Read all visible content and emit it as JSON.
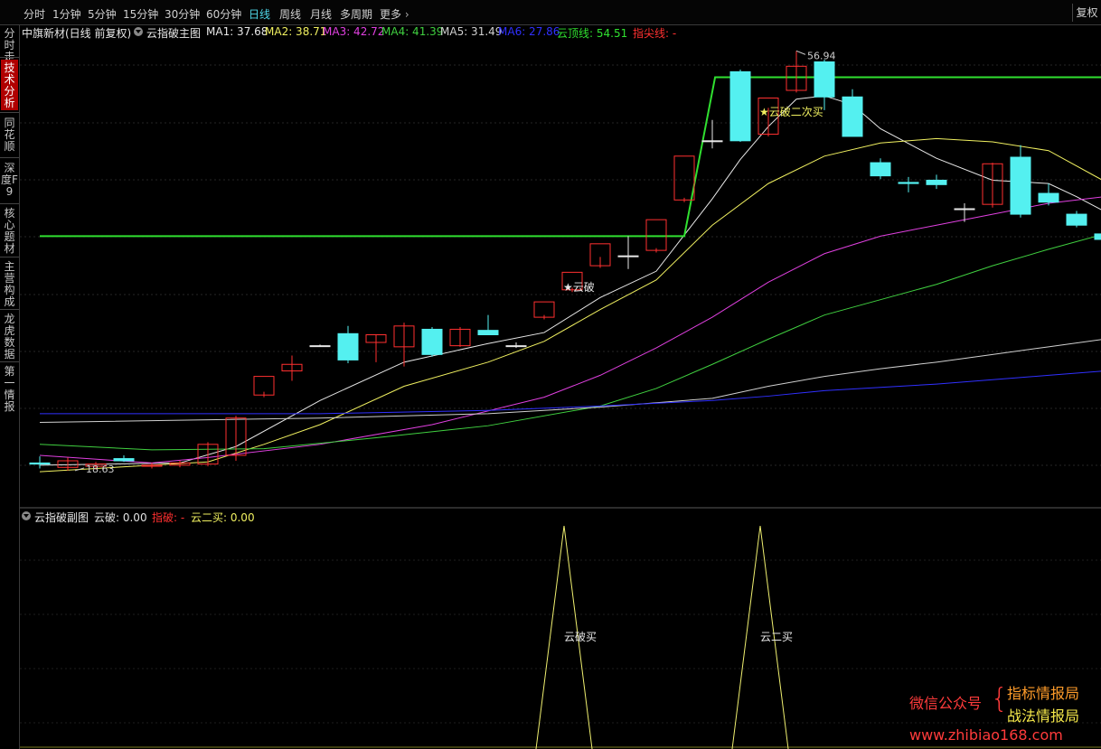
{
  "toolbar": {
    "periods": [
      "分时",
      "1分钟",
      "5分钟",
      "15分钟",
      "30分钟",
      "60分钟",
      "日线",
      "周线",
      "月线",
      "多周期",
      "更多"
    ],
    "active_period": "日线",
    "fuquan_label": "复权"
  },
  "sidebar": {
    "tabs": [
      "分时走势",
      "技术分析",
      "同花顺",
      "深度F9",
      "核心题材",
      "主营构成",
      "龙虎数据",
      "第一情报"
    ],
    "active_tab": "技术分析"
  },
  "main_header": {
    "stock": "中旗新材(日线 前复权)",
    "indicator": "云指破主图",
    "items": [
      {
        "label": "MA1: 37.68",
        "color": "#e8e8e8"
      },
      {
        "label": "MA2: 38.71",
        "color": "#f0f060"
      },
      {
        "label": "MA3: 42.72",
        "color": "#e040e0"
      },
      {
        "label": "MA4: 41.39",
        "color": "#40d040"
      },
      {
        "label": "MA5: 31.49",
        "color": "#d0d0d0"
      },
      {
        "label": "MA6: 27.86",
        "color": "#3030ff"
      },
      {
        "label": "云顶线: 54.51",
        "color": "#30e030"
      },
      {
        "label": "指尖线: -",
        "color": "#ff3030"
      }
    ]
  },
  "sub_header": {
    "indicator": "云指破副图",
    "items": [
      {
        "label": "云破: 0.00",
        "color": "#e0e0e0"
      },
      {
        "label": "指破: -",
        "color": "#ff3030"
      },
      {
        "label": "云二买: 0.00",
        "color": "#f0f060"
      }
    ]
  },
  "chart_data": {
    "type": "candlestick",
    "ylim": [
      17,
      58
    ],
    "high_label": "56.94",
    "low_label": "18.63",
    "colors": {
      "up": "#ff3030",
      "down": "#54f0f0",
      "doji": "#e8e8e8",
      "cloud_top": "#30e030",
      "background": "#000000"
    },
    "candles": [
      {
        "o": 19.3,
        "h": 19.9,
        "l": 18.8,
        "c": 19.2
      },
      {
        "o": 18.9,
        "h": 19.8,
        "l": 18.6,
        "c": 19.5
      },
      {
        "o": 19.0,
        "h": 19.4,
        "l": 18.7,
        "c": 19.2
      },
      {
        "o": 19.7,
        "h": 20.0,
        "l": 19.4,
        "c": 19.5
      },
      {
        "o": 19.0,
        "h": 19.3,
        "l": 18.8,
        "c": 19.1
      },
      {
        "o": 19.1,
        "h": 19.5,
        "l": 18.9,
        "c": 19.3
      },
      {
        "o": 19.2,
        "h": 21.2,
        "l": 19.0,
        "c": 21.0
      },
      {
        "o": 20.0,
        "h": 23.6,
        "l": 19.5,
        "c": 23.4
      },
      {
        "o": 25.5,
        "h": 25.8,
        "l": 25.3,
        "c": 27.2
      },
      {
        "o": 27.7,
        "h": 29.1,
        "l": 26.8,
        "c": 28.3
      },
      {
        "o": 30.0,
        "h": 30.1,
        "l": 29.9,
        "c": 30.0
      },
      {
        "o": 31.1,
        "h": 31.8,
        "l": 28.4,
        "c": 28.7
      },
      {
        "o": 30.3,
        "h": 31.0,
        "l": 28.5,
        "c": 31.0
      },
      {
        "o": 29.9,
        "h": 32.1,
        "l": 28.1,
        "c": 31.8
      },
      {
        "o": 31.5,
        "h": 31.7,
        "l": 29.0,
        "c": 29.2
      },
      {
        "o": 30.0,
        "h": 31.7,
        "l": 29.9,
        "c": 31.5
      },
      {
        "o": 31.4,
        "h": 32.8,
        "l": 31.0,
        "c": 31.0
      },
      {
        "o": 30.0,
        "h": 30.3,
        "l": 29.8,
        "c": 30.0
      },
      {
        "o": 32.6,
        "h": 32.8,
        "l": 32.4,
        "c": 34.0
      },
      {
        "o": 35.1,
        "h": 35.3,
        "l": 34.9,
        "c": 36.7
      },
      {
        "o": 37.3,
        "h": 38.1,
        "l": 37.1,
        "c": 39.3
      },
      {
        "o": 38.2,
        "h": 40.0,
        "l": 37.0,
        "c": 38.2
      },
      {
        "o": 38.7,
        "h": 38.9,
        "l": 38.5,
        "c": 41.5
      },
      {
        "o": 43.3,
        "h": 43.5,
        "l": 43.1,
        "c": 47.3
      },
      {
        "o": 48.7,
        "h": 50.6,
        "l": 48.0,
        "c": 48.7
      },
      {
        "o": 55.0,
        "h": 55.2,
        "l": 48.6,
        "c": 48.7
      },
      {
        "o": 49.3,
        "h": 51.7,
        "l": 49.1,
        "c": 52.6
      },
      {
        "o": 53.3,
        "h": 56.9,
        "l": 53.1,
        "c": 55.5
      },
      {
        "o": 55.9,
        "h": 56.1,
        "l": 51.5,
        "c": 52.7
      },
      {
        "o": 52.7,
        "h": 53.4,
        "l": 49.1,
        "c": 49.1
      },
      {
        "o": 46.7,
        "h": 47.1,
        "l": 45.2,
        "c": 45.5
      },
      {
        "o": 44.9,
        "h": 45.4,
        "l": 44.0,
        "c": 44.8
      },
      {
        "o": 45.1,
        "h": 45.6,
        "l": 44.3,
        "c": 44.7
      },
      {
        "o": 42.5,
        "h": 43.0,
        "l": 41.3,
        "c": 42.5
      },
      {
        "o": 42.9,
        "h": 46.7,
        "l": 42.6,
        "c": 46.6
      },
      {
        "o": 47.2,
        "h": 48.3,
        "l": 41.7,
        "c": 42.0
      },
      {
        "o": 43.9,
        "h": 44.8,
        "l": 42.8,
        "c": 43.1
      },
      {
        "o": 42.0,
        "h": 42.3,
        "l": 40.8,
        "c": 41.0
      },
      {
        "o": 40.2,
        "h": 40.7,
        "l": 39.3,
        "c": 39.7
      },
      {
        "o": 39.4,
        "h": 39.6,
        "l": 36.4,
        "c": 38.1
      }
    ],
    "ma_lines": [
      {
        "name": "MA1",
        "color": "#e8e8e8",
        "points": [
          [
            0,
            19.1
          ],
          [
            5,
            19.3
          ],
          [
            7,
            20.8
          ],
          [
            10,
            25.0
          ],
          [
            13,
            28.5
          ],
          [
            16,
            30.2
          ],
          [
            18,
            31.2
          ],
          [
            20,
            34.4
          ],
          [
            22,
            36.8
          ],
          [
            24,
            43.4
          ],
          [
            25,
            47.0
          ],
          [
            26,
            50.0
          ],
          [
            27,
            52.5
          ],
          [
            28,
            52.8
          ],
          [
            29,
            52.0
          ],
          [
            30,
            49.8
          ],
          [
            32,
            47.1
          ],
          [
            34,
            45.1
          ],
          [
            36,
            44.8
          ],
          [
            37,
            43.6
          ],
          [
            39,
            40.9
          ]
        ]
      },
      {
        "name": "MA2",
        "color": "#f0f060",
        "points": [
          [
            0,
            18.5
          ],
          [
            6,
            19.4
          ],
          [
            8,
            21.0
          ],
          [
            10,
            22.8
          ],
          [
            13,
            26.3
          ],
          [
            16,
            28.5
          ],
          [
            18,
            30.4
          ],
          [
            20,
            33.3
          ],
          [
            22,
            36.0
          ],
          [
            24,
            41.0
          ],
          [
            26,
            44.8
          ],
          [
            28,
            47.3
          ],
          [
            30,
            48.5
          ],
          [
            32,
            48.9
          ],
          [
            34,
            48.6
          ],
          [
            36,
            47.8
          ],
          [
            38,
            45.0
          ],
          [
            39,
            43.4
          ]
        ]
      },
      {
        "name": "MA3",
        "color": "#e040e0",
        "points": [
          [
            0,
            20.0
          ],
          [
            4,
            19.3
          ],
          [
            6,
            19.8
          ],
          [
            10,
            21.0
          ],
          [
            14,
            22.8
          ],
          [
            18,
            25.3
          ],
          [
            20,
            27.3
          ],
          [
            22,
            29.8
          ],
          [
            24,
            32.6
          ],
          [
            26,
            35.8
          ],
          [
            28,
            38.4
          ],
          [
            30,
            40.0
          ],
          [
            32,
            41.0
          ],
          [
            34,
            42.0
          ],
          [
            36,
            43.0
          ],
          [
            38,
            43.6
          ],
          [
            39,
            43.7
          ]
        ]
      },
      {
        "name": "MA4",
        "color": "#40d040",
        "points": [
          [
            0,
            21.0
          ],
          [
            4,
            20.5
          ],
          [
            8,
            20.6
          ],
          [
            12,
            21.6
          ],
          [
            16,
            22.7
          ],
          [
            20,
            24.5
          ],
          [
            22,
            26.1
          ],
          [
            24,
            28.3
          ],
          [
            26,
            30.6
          ],
          [
            28,
            32.8
          ],
          [
            30,
            34.2
          ],
          [
            32,
            35.6
          ],
          [
            34,
            37.3
          ],
          [
            36,
            38.8
          ],
          [
            38,
            40.2
          ],
          [
            39,
            40.8
          ]
        ]
      },
      {
        "name": "MA5",
        "color": "#d0d0d0",
        "points": [
          [
            0,
            23.0
          ],
          [
            10,
            23.4
          ],
          [
            16,
            23.8
          ],
          [
            20,
            24.4
          ],
          [
            24,
            25.2
          ],
          [
            26,
            26.3
          ],
          [
            28,
            27.2
          ],
          [
            30,
            27.9
          ],
          [
            32,
            28.5
          ],
          [
            34,
            29.2
          ],
          [
            36,
            29.9
          ],
          [
            38,
            30.6
          ],
          [
            39,
            30.9
          ]
        ]
      },
      {
        "name": "MA6",
        "color": "#3030ff",
        "points": [
          [
            0,
            23.8
          ],
          [
            10,
            23.8
          ],
          [
            16,
            24.1
          ],
          [
            20,
            24.5
          ],
          [
            24,
            25.0
          ],
          [
            26,
            25.4
          ],
          [
            28,
            25.9
          ],
          [
            30,
            26.2
          ],
          [
            32,
            26.5
          ],
          [
            34,
            26.9
          ],
          [
            36,
            27.3
          ],
          [
            38,
            27.7
          ],
          [
            39,
            27.9
          ]
        ]
      }
    ],
    "cloud_top_line": {
      "name": "云顶线",
      "points": [
        [
          0,
          40.0
        ],
        [
          23,
          40.0
        ],
        [
          24.1,
          54.5
        ],
        [
          39.5,
          54.5
        ]
      ]
    },
    "annotations": [
      {
        "text": "★云破",
        "index": 19,
        "y": 35.0,
        "color": "#e8e8e8"
      },
      {
        "text": "★云破二次买",
        "index": 26,
        "y": 51.0,
        "color": "#f0f060"
      }
    ],
    "sub_chart": {
      "signals": [
        {
          "index": 19,
          "label": "云破买"
        },
        {
          "index": 26,
          "label": "云二买"
        }
      ]
    }
  },
  "watermark": {
    "wechat": "微信公众号",
    "brace": "{",
    "name1": "指标情报局",
    "name2": "战法情报局",
    "url": "www.zhibiao168.com"
  }
}
